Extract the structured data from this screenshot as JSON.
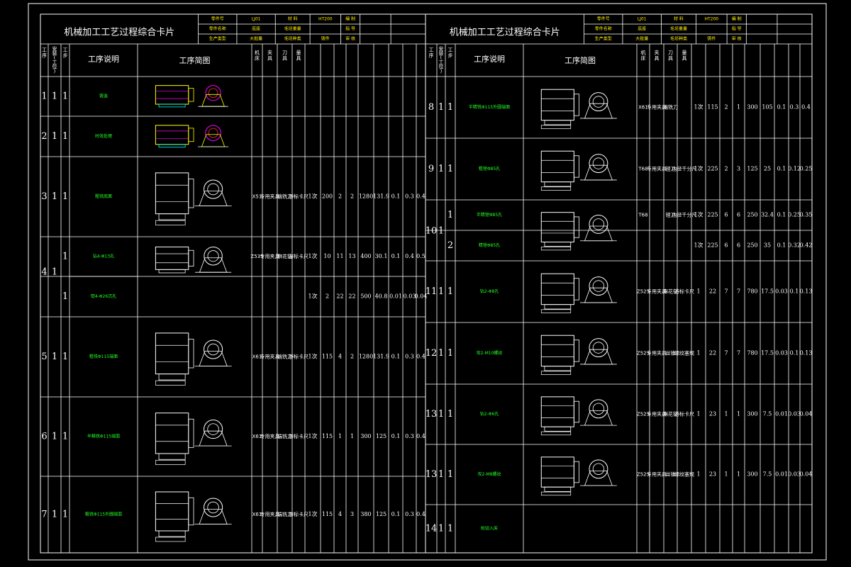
{
  "colors": {
    "background": "#000000",
    "lines": "#ffffff",
    "text_green": "#22ff22",
    "text_yellow": "#ffee00",
    "drawing_yellow": "#ffff00",
    "drawing_magenta": "#ff00ff",
    "drawing_cyan": "#00ffff",
    "drawing_red": "#ff3333"
  },
  "left_card": {
    "title": "机械加工工艺过程综合卡片",
    "meta": [
      {
        "label": "零件号",
        "value": "LJ01",
        "label2": "材 料",
        "value2": "HT200",
        "label3": "编 制",
        "value3": ""
      },
      {
        "label": "零件名称",
        "value": "底座",
        "label2": "毛坯重量",
        "value2": "",
        "label3": "指 导",
        "value3": ""
      },
      {
        "label": "生产类型",
        "value": "大批量",
        "label2": "毛坯种类",
        "value2": "铸件",
        "label3": "审 核",
        "value3": ""
      }
    ],
    "col_headers": [
      "工序",
      "安装(工位)",
      "工步",
      "工序说明",
      "工序简图",
      "机床",
      "夹具",
      "刀具",
      "量具"
    ],
    "rows": [
      {
        "op": "1",
        "inst": "1",
        "step": "1",
        "desc": "铸造",
        "mach": "",
        "fixt": "",
        "tool": "",
        "meas": "",
        "vals": []
      },
      {
        "op": "2",
        "inst": "1",
        "step": "1",
        "desc": "时效处理",
        "mach": "",
        "fixt": "",
        "tool": "",
        "meas": "",
        "vals": []
      },
      {
        "op": "3",
        "inst": "1",
        "step": "1",
        "desc": "粗铣底面",
        "mach": "X51",
        "fixt": "专用夹具",
        "tool": "端铣刀",
        "meas": "游标卡尺",
        "vals": [
          "1次",
          "200",
          "2",
          "2",
          "1280",
          "131.9",
          "0.1",
          "0.3",
          "0.4"
        ]
      },
      {
        "op": "4",
        "inst": "1",
        "step": "1",
        "desc": "钻4-Φ13孔",
        "mach": "Z535",
        "fixt": "专用夹具",
        "tool": "麻花钻",
        "meas": "游标卡尺",
        "vals": [
          "1次",
          "10",
          "11",
          "13",
          "400",
          "30.1",
          "0.1",
          "0.4",
          "0.5"
        ]
      },
      {
        "op": "",
        "inst": "",
        "step": "1",
        "desc": "锪4-Φ26沉孔",
        "mach": "",
        "fixt": "",
        "tool": "",
        "meas": "",
        "vals": [
          "1次",
          "2",
          "22",
          "22",
          "500",
          "40.8",
          "0.01",
          "0.03",
          "0.04"
        ]
      },
      {
        "op": "5",
        "inst": "1",
        "step": "1",
        "desc": "粗铣Φ115端面",
        "mach": "X61",
        "fixt": "专用夹具",
        "tool": "端铣刀",
        "meas": "游标卡尺",
        "vals": [
          "1次",
          "115",
          "4",
          "2",
          "1280",
          "131.9",
          "0.1",
          "0.3",
          "0.4"
        ]
      },
      {
        "op": "6",
        "inst": "1",
        "step": "1",
        "desc": "半精铣Φ115端面",
        "mach": "X61",
        "fixt": "专用夹具",
        "tool": "端铣刀",
        "meas": "游标卡尺",
        "vals": [
          "1次",
          "115",
          "1",
          "1",
          "300",
          "125",
          "0.1",
          "0.3",
          "0.4"
        ]
      },
      {
        "op": "7",
        "inst": "1",
        "step": "1",
        "desc": "粗铣Φ115外圆端面",
        "mach": "X61",
        "fixt": "专用夹具",
        "tool": "端铣刀",
        "meas": "游标卡尺",
        "vals": [
          "1次",
          "115",
          "4",
          "3",
          "380",
          "125",
          "0.1",
          "0.3",
          "0.4"
        ]
      }
    ]
  },
  "right_card": {
    "title": "机械加工工艺过程综合卡片",
    "meta": [
      {
        "label": "零件号",
        "value": "LJ01",
        "label2": "材 料",
        "value2": "HT200",
        "label3": "编 制",
        "value3": ""
      },
      {
        "label": "零件名称",
        "value": "底座",
        "label2": "毛坯重量",
        "value2": "",
        "label3": "指 导",
        "value3": ""
      },
      {
        "label": "生产类型",
        "value": "大批量",
        "label2": "毛坯种类",
        "value2": "铸件",
        "label3": "审 核",
        "value3": ""
      }
    ],
    "col_headers": [
      "工序",
      "安装(工位)",
      "工步",
      "工序说明",
      "工序简图",
      "机床",
      "夹具",
      "刀具",
      "量具"
    ],
    "rows": [
      {
        "op": "8",
        "inst": "1",
        "step": "1",
        "desc": "半精铣Φ115外圆端面",
        "mach": "X61",
        "fixt": "专用夹具",
        "tool": "端铣刀",
        "meas": "",
        "vals": [
          "1次",
          "115",
          "2",
          "1",
          "300",
          "105",
          "0.1",
          "0.3",
          "0.4"
        ]
      },
      {
        "op": "9",
        "inst": "1",
        "step": "1",
        "desc": "粗镗Φ85孔",
        "mach": "T68",
        "fixt": "专用夹具",
        "tool": "镗刀",
        "meas": "内径千分尺",
        "vals": [
          "1次",
          "225",
          "2",
          "3",
          "125",
          "25",
          "0.1",
          "0.12",
          "0.25"
        ]
      },
      {
        "op": "10",
        "inst": "1",
        "step": "1",
        "desc": "半精镗Φ85孔",
        "mach": "T68",
        "fixt": "",
        "tool": "镗刀",
        "meas": "内径千分尺",
        "vals": [
          "1次",
          "225",
          "6",
          "6",
          "250",
          "32.4",
          "0.1",
          "0.25",
          "0.35"
        ]
      },
      {
        "op": "",
        "inst": "",
        "step": "2",
        "desc": "精镗Φ85孔",
        "mach": "",
        "fixt": "",
        "tool": "",
        "meas": "",
        "vals": [
          "1次",
          "225",
          "6",
          "6",
          "250",
          "35",
          "0.1",
          "0.32",
          "0.42"
        ]
      },
      {
        "op": "11",
        "inst": "1",
        "step": "1",
        "desc": "钻2-Φ8孔",
        "mach": "Z525",
        "fixt": "专用夹具",
        "tool": "麻花钻",
        "meas": "游标卡尺",
        "vals": [
          "1",
          "22",
          "7",
          "7",
          "780",
          "17.5",
          "0.03",
          "0.1",
          "0.13"
        ]
      },
      {
        "op": "12",
        "inst": "1",
        "step": "1",
        "desc": "攻2-M10螺纹",
        "mach": "Z525",
        "fixt": "专用夹具",
        "tool": "丝锥",
        "meas": "螺纹塞规",
        "vals": [
          "1",
          "22",
          "7",
          "7",
          "780",
          "17.5",
          "0.03",
          "0.1",
          "0.13"
        ]
      },
      {
        "op": "13",
        "inst": "1",
        "step": "1",
        "desc": "钻2-Φ6孔",
        "mach": "Z525",
        "fixt": "专用夹具",
        "tool": "麻花钻",
        "meas": "游标卡尺",
        "vals": [
          "1",
          "23",
          "1",
          "1",
          "300",
          "7.5",
          "0.01",
          "0.03",
          "0.04"
        ]
      },
      {
        "op": "13",
        "inst": "1",
        "step": "1",
        "desc": "攻2-M8螺纹",
        "mach": "Z525",
        "fixt": "专用夹具",
        "tool": "丝锥",
        "meas": "螺纹塞规",
        "vals": [
          "1",
          "23",
          "1",
          "1",
          "300",
          "7.5",
          "0.01",
          "0.03",
          "0.04"
        ]
      },
      {
        "op": "14",
        "inst": "1",
        "step": "1",
        "desc": "检验入库",
        "mach": "",
        "fixt": "",
        "tool": "",
        "meas": "",
        "vals": []
      }
    ]
  }
}
